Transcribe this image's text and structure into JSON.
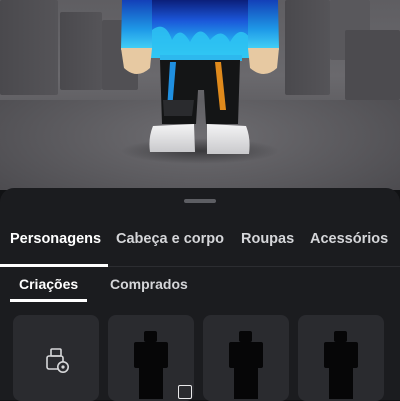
{
  "tabs": {
    "categories": [
      {
        "label": "Personagens",
        "active": true
      },
      {
        "label": "Cabeça e corpo",
        "active": false
      },
      {
        "label": "Roupas",
        "active": false
      },
      {
        "label": "Acessórios",
        "active": false
      }
    ],
    "subtabs": [
      {
        "label": "Criações",
        "active": true
      },
      {
        "label": "Comprados",
        "active": false
      }
    ]
  },
  "tiles": [
    {
      "icon": "create-character-icon"
    },
    {
      "icon": "character-silhouette-icon",
      "badge": "owned-badge-icon"
    },
    {
      "icon": "character-silhouette-icon"
    },
    {
      "icon": "character-silhouette-icon"
    }
  ],
  "colors": {
    "sheet_background": "#1b1c1f",
    "tile_background": "#2a2b2f",
    "active_text": "#ffffff",
    "inactive_text": "#d5d6d9",
    "hoodie_blue": "#1aa7e6",
    "shoes": "#e8e8ea"
  }
}
